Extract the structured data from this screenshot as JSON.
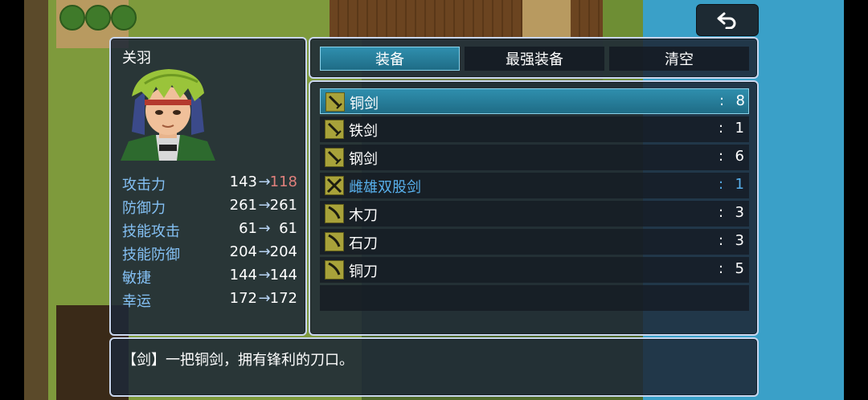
{
  "actor": {
    "name": "关羽",
    "stats": [
      {
        "label": "攻击力",
        "current": "143",
        "arrow": "→",
        "new": "118",
        "decrease": true
      },
      {
        "label": "防御力",
        "current": "261",
        "arrow": "→",
        "new": "261",
        "decrease": false
      },
      {
        "label": "技能攻击",
        "current": "61",
        "arrow": "→",
        "new": "61",
        "decrease": false
      },
      {
        "label": "技能防御",
        "current": "204",
        "arrow": "→",
        "new": "204",
        "decrease": false
      },
      {
        "label": "敏捷",
        "current": "144",
        "arrow": "→",
        "new": "144",
        "decrease": false
      },
      {
        "label": "幸运",
        "current": "172",
        "arrow": "→",
        "new": "172",
        "decrease": false
      }
    ]
  },
  "commands": [
    {
      "label": "装备",
      "active": true
    },
    {
      "label": "最强装备",
      "active": false
    },
    {
      "label": "清空",
      "active": false
    }
  ],
  "items": [
    {
      "name": "铜剑",
      "colon": ":",
      "count": "8",
      "selected": true,
      "icon": "sword-icon"
    },
    {
      "name": "铁剑",
      "colon": ":",
      "count": "1",
      "selected": false,
      "icon": "sword-icon"
    },
    {
      "name": "钢剑",
      "colon": ":",
      "count": "6",
      "selected": false,
      "icon": "sword-icon"
    },
    {
      "name": "雌雄双股剑",
      "colon": ":",
      "count": "1",
      "selected": false,
      "icon": "crossed-swords-icon",
      "highlight": true
    },
    {
      "name": "木刀",
      "colon": ":",
      "count": "3",
      "selected": false,
      "icon": "blade-icon"
    },
    {
      "name": "石刀",
      "colon": ":",
      "count": "3",
      "selected": false,
      "icon": "blade-icon"
    },
    {
      "name": "铜刀",
      "colon": ":",
      "count": "5",
      "selected": false,
      "icon": "blade-icon"
    }
  ],
  "help": {
    "text": "【剑】一把铜剑，拥有锋利的刀口。"
  },
  "colors": {
    "accent": "#2f8fae",
    "stat_label": "#84c0f4",
    "decrease": "#e0807c",
    "highlight": "#58b0ec"
  }
}
